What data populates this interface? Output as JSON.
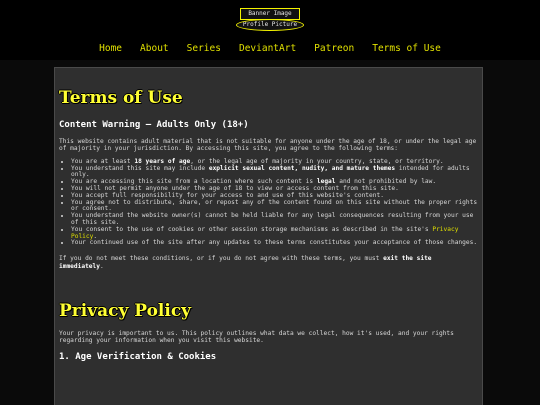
{
  "header": {
    "banner_alt": "Banner Image",
    "profile_alt": "Profile Picture"
  },
  "nav": {
    "home": "Home",
    "about": "About",
    "series": "Series",
    "deviantart": "DeviantArt",
    "patreon": "Patreon",
    "terms": "Terms of Use"
  },
  "terms": {
    "title": "Terms of Use",
    "warning": "Content Warning – Adults Only (18+)",
    "intro": "This website contains adult material that is not suitable for anyone under the age of 18, or under the legal age of majority in your jurisdiction. By accessing this site, you agree to the following terms:",
    "items": {
      "i0a": "You are at least ",
      "i0b": "18 years of age",
      "i0c": ", or the legal age of majority in your country, state, or territory.",
      "i1a": "You understand this site may include ",
      "i1b": "explicit sexual content, nudity, and mature themes",
      "i1c": " intended for adults only.",
      "i2a": "You are accessing this site from a location where such content is ",
      "i2b": "legal",
      "i2c": " and not prohibited by law.",
      "i3": "You will not permit anyone under the age of 18 to view or access content from this site.",
      "i4": "You accept full responsibility for your access to and use of this website's content.",
      "i5": "You agree not to distribute, share, or repost any of the content found on this site without the proper rights or consent.",
      "i6": "You understand the website owner(s) cannot be held liable for any legal consequences resulting from your use of this site.",
      "i7a": "You consent to the use of cookies or other session storage mechanisms as described in the site's ",
      "i7link": "Privacy Policy",
      "i7c": ".",
      "i8": "Your continued use of the site after any updates to these terms constitutes your acceptance of those changes."
    },
    "exit_a": "If you do not meet these conditions, or if you do not agree with these terms, you must ",
    "exit_b": "exit the site immediately",
    "exit_c": "."
  },
  "privacy": {
    "title": "Privacy Policy",
    "intro": "Your privacy is important to us. This policy outlines what data we collect, how it's used, and your rights regarding your information when you visit this website.",
    "section1": "1. Age Verification & Cookies"
  },
  "colors": {
    "accent": "#ffff33",
    "nav": "#e0e000",
    "panel": "#2f2f2f",
    "page": "#0a0a0a"
  }
}
